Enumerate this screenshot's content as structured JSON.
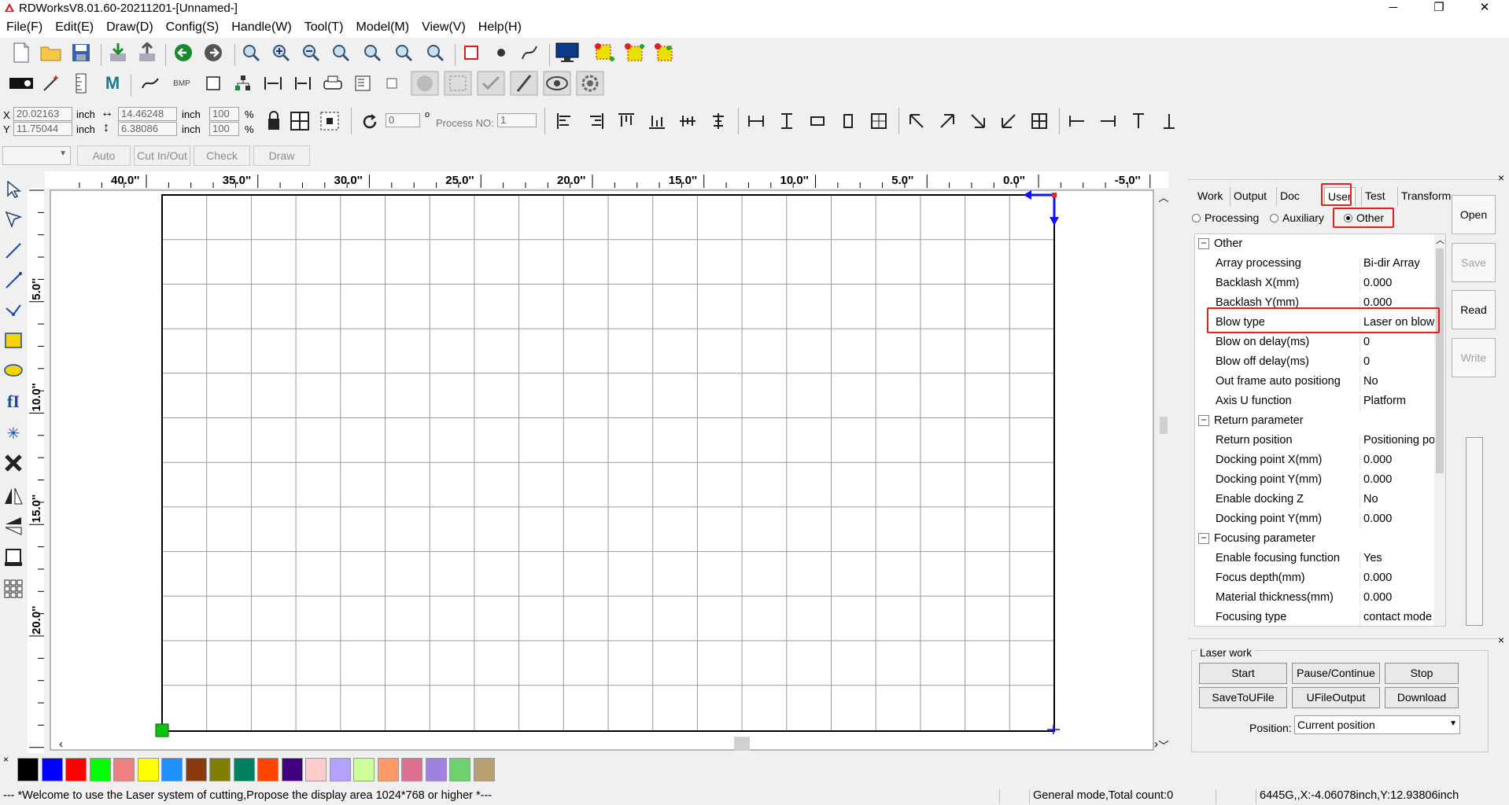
{
  "window": {
    "title": "RDWorksV8.01.60-20211201-[Unnamed-]",
    "minimize": "─",
    "maximize": "❐",
    "close": "✕"
  },
  "menu": [
    "File(F)",
    "Edit(E)",
    "Draw(D)",
    "Config(S)",
    "Handle(W)",
    "Tool(T)",
    "Model(M)",
    "View(V)",
    "Help(H)"
  ],
  "coords": {
    "x_label": "X",
    "y_label": "Y",
    "unit": "inch",
    "pct": "%",
    "x": "20.02163",
    "y": "11.75044",
    "width": "14.46248",
    "height": "6.38086",
    "scale_w": "100",
    "scale_h": "100",
    "angle": "0",
    "degree_sign": "o",
    "process_no_label": "Process NO:",
    "process_no": "1"
  },
  "toolbar_row4": {
    "auto": "Auto",
    "cut_in_out": "Cut In/Out",
    "check": "Check",
    "draw": "Draw"
  },
  "ruler": {
    "h_labels": [
      "40.0''",
      "35.0''",
      "30.0''",
      "25.0''",
      "20.0''",
      "15.0''",
      "10.0''",
      "5.0''",
      "0.0''",
      "-5.0''"
    ],
    "v_labels": [
      "5.0''",
      "10.0''",
      "15.0''",
      "20.0''"
    ]
  },
  "panel": {
    "tabs": [
      "Work",
      "Output",
      "Doc",
      "User",
      "Test",
      "Transform"
    ],
    "active_tab": "User",
    "radios": [
      "Processing",
      "Auxiliary",
      "Other"
    ],
    "selected_radio": "Other",
    "rows": [
      {
        "type": "group",
        "label": "Other"
      },
      {
        "type": "prop",
        "key": "Array processing",
        "value": "Bi-dir Array"
      },
      {
        "type": "prop",
        "key": "Backlash X(mm)",
        "value": "0.000"
      },
      {
        "type": "prop",
        "key": "Backlash Y(mm)",
        "value": "0.000"
      },
      {
        "type": "prop",
        "key": "Blow type",
        "value": "Laser on blow"
      },
      {
        "type": "prop",
        "key": "Blow on delay(ms)",
        "value": "0"
      },
      {
        "type": "prop",
        "key": "Blow off delay(ms)",
        "value": "0"
      },
      {
        "type": "prop",
        "key": "Out frame auto positiong",
        "value": "No"
      },
      {
        "type": "prop",
        "key": "Axis U function",
        "value": "Platform"
      },
      {
        "type": "group",
        "label": "Return parameter"
      },
      {
        "type": "prop",
        "key": "Return position",
        "value": "Positioning point"
      },
      {
        "type": "prop",
        "key": "Docking point X(mm)",
        "value": "0.000"
      },
      {
        "type": "prop",
        "key": "Docking point Y(mm)",
        "value": "0.000"
      },
      {
        "type": "prop",
        "key": "Enable docking Z",
        "value": "No"
      },
      {
        "type": "prop",
        "key": "Docking point Y(mm)",
        "value": "0.000"
      },
      {
        "type": "group",
        "label": "Focusing parameter"
      },
      {
        "type": "prop",
        "key": "Enable focusing function",
        "value": "Yes"
      },
      {
        "type": "prop",
        "key": "Focus depth(mm)",
        "value": "0.000"
      },
      {
        "type": "prop",
        "key": "Material thickness(mm)",
        "value": "0.000"
      },
      {
        "type": "prop",
        "key": "Focusing type",
        "value": "contact mode"
      }
    ],
    "buttons": {
      "open": "Open",
      "save": "Save",
      "read": "Read",
      "write": "Write"
    },
    "close_glyph": "×"
  },
  "laser_work": {
    "title": "Laser work",
    "start": "Start",
    "pause": "Pause/Continue",
    "stop": "Stop",
    "save_to_ufile": "SaveToUFile",
    "ufile_output": "UFileOutput",
    "download": "Download",
    "position_label": "Position:",
    "position_value": "Current position"
  },
  "palette": {
    "colors": [
      "#000000",
      "#0000ff",
      "#ff0000",
      "#00ff00",
      "#f08080",
      "#ffff00",
      "#1e90ff",
      "#8b3a0f",
      "#808000",
      "#008060",
      "#ff4500",
      "#400080",
      "#ffcccc",
      "#b4a0ff",
      "#ccff99",
      "#ff9966",
      "#e07090",
      "#a080e0",
      "#70d070",
      "#b8a070"
    ]
  },
  "status": {
    "message": "--- *Welcome to use the Laser system of cutting,Propose the display area 1024*768 or higher *---",
    "mode": "General mode,Total count:0",
    "position": "6445G,,X:-4.06078inch,Y:12.93806inch"
  }
}
